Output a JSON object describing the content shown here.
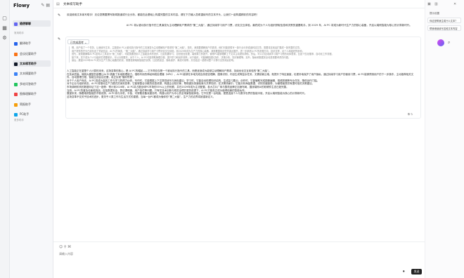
{
  "app": {
    "brand": "Flowy"
  },
  "topbar": {
    "title": "文本续写助手"
  },
  "sidebar": {
    "recent_item": "随便聊聊",
    "section_common": "常用助手",
    "items": [
      {
        "label": "翻译助手",
        "color": "#2563eb"
      },
      {
        "label": "会议纪要助手",
        "color": "#f97316"
      },
      {
        "label": "文本续写助手",
        "color": "#111827"
      },
      {
        "label": "文本摘要助手",
        "color": "#3b82f6"
      },
      {
        "label": "多轮问答助手",
        "color": "#22c55e"
      },
      {
        "label": "图像理解助手",
        "color": "#ef4444"
      },
      {
        "label": "简报助手",
        "color": "#f59e0b"
      },
      {
        "label": "PC助手",
        "color": "#0ea5e9"
      }
    ],
    "section_more": "更多助手"
  },
  "messages": {
    "first": "欢迎使用文本续写助手！无论您需要撰写新闻报道或行业分析，都能在此基础上构建完整的文本内容。请在下方输入您希望续写的文本开头，让我们一起构建精彩的内容吧！",
    "user_question": "AI PC 将从被动执行指令的工具演变为主动理解用户需求的“第二大脑”，通过持续学习用户习惯，优化交互体验。最终成为个人与组织获取信息和决策的重要助手。到 2029 年，AI PC 将成为新时代生产力的核心装备，开启以端侧智能为核心的计算新时代。",
    "chip": "已完成思考",
    "quote_lines": [
      "嗯，用户给了一个任务，让我续写文本，主题是AI PC从被动执行指令的工具演变为主动理解用户需求的“第二大脑”。首先，我需要理解用户的需求。他们可能是想写一篇行业分析或者科技文章，需要将这段话扩展成一篇完整的文章。",
      "用户提供的开头已经包含了关键信息：AI PC的演变，“第二大脑”，通过持续学习用户习惯优化交互体验，到2029年成为生产力的核心装备。我需要围绕这些关键点展开，进一步阐述AI PC的发展方向、技术支撑、对个人和组织的影响。",
      "首先，我需要解释AI PC如何从工具变为“第二大脑”。可能需要提到人工智能技术的进步，比如机器学习、自然语言处理、端侧算力的提升，使得PC能够理解上下文并主动提供帮助。然后，可以讨论持续学习用户习惯的具体表现，比如个性化推荐、自动化工作流程。",
      "接下来，关于成为个人与组织的重要助手，可以分别展开。对于个人，AI PC可能帮助管理日程、提升学习和创作效率；对于组织，可能辅助团队协作、决策分析、知识管理等。另外，隐私和数据安全也是需要考虑的问题。",
      "最后，展望2029年AI PC成为生产力核心装备的前景，需要强调端侧智能的优势，比如低延迟、隐私保护、离线可用等，并总结这一趋势对整个计算行业的深远影响。"
    ],
    "answer_paragraphs": [
      "人工智能正在重塑个人计算的未来。这场变革的核心，是 AI PC的崛起——它不再仅仅是一个被动执行指令的工具，而是逐渐成为能够主动理解用户需求、持续优化交互体验的“第二大脑”。",
      "在技术层面，端侧大模型的部署让AI PC具备了本地推理能力。借助专用的神经网络处理器（NPU），AI PC能够在本地完成自然语言理解、图像识别、内容生成等复杂任务，无需依赖云端，既提升了响应速度，也更好地保护了用户隐私。通过持续学习用户的使用习惯，AI PC能够预测用户的下一步操作，主动推荐相关文件、自动整理日程、智能生成会议纪要，真正实现“懂你所需”。",
      "对于个人用户而言，AI PC将成为高效工作与学习的得力伙伴。写作时，它能根据上下文提供续写与润色建议；学习时，它能自动梳理知识结构、生成复习要点；创作时，它能辅助完成图像编辑、视频剪辑等专业任务，降低创作门槛。",
      "对于企业与组织而言，AI PC将推动生产力模式的深刻变革。它能够整合分散的信息资源，构建企业知识库，帮助团队快速检索与共享知识；在决策场景中，它能分析海量数据、识别关键趋势，为管理者提供有据可依的决策建议。",
      "市场调研机构的数据印证了这一趋势：预计到2026年，AI PC将占据全球PC市场的55%以上的份额，并在2029年成为主流配置。各大芯片厂商与整机品牌正加速布局，围绕端侧AI的软硬件生态日趋完善。",
      "当然，AI PC的普及也面临挑战，包括数据安全、算法透明度、用户信任等问题。只有在技术创新与规范治理并重的前提下，AI PC才能真正成为值得信赖的智能伙伴。",
      "展望未来，随着端侧智能的不断成熟，AI PC将与手机、平板、可穿戴设备深度协同，构建以用户为中心的全场景智能体验。它不仅是一台电脑，更是连接个人与数字世界的智能中枢，开启以端侧智能为核心的计算新时代。",
      "这场变革不仅关乎技术的进步，更关乎人类工作与生活方式的重塑。当每一台PC都成为懂你的“第二大脑”，生产力的边界将被重新定义。"
    ]
  },
  "input": {
    "placeholder": "请输入内容",
    "send_label": "发送"
  },
  "right_panel": {
    "label": "提示设置",
    "items": [
      "你这是帮我生成什么文本？",
      "帮我继续续写这段文本内容"
    ]
  },
  "colors": {
    "accent": "#111827",
    "brand_gradient": [
      "#d946ef",
      "#6366f1"
    ]
  }
}
